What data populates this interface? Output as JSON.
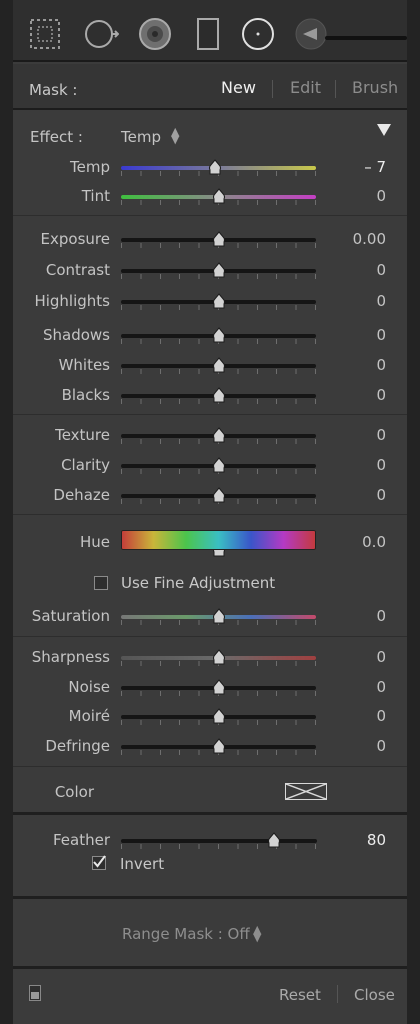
{
  "mask": {
    "label": "Mask :",
    "buttons": [
      "New",
      "Edit",
      "Brush"
    ],
    "active": "New"
  },
  "toolbar": {
    "tools": [
      "marquee-icon",
      "spot-removal-icon",
      "redeye-icon",
      "graduated-filter-icon",
      "radial-filter-icon",
      "brush-tool-icon"
    ]
  },
  "effect": {
    "label": "Effect :",
    "value": "Temp",
    "collapse_icon": "triangle-down-icon"
  },
  "sliders": [
    {
      "label": "Temp",
      "value": "– 7",
      "position": 0.48,
      "track": "temp"
    },
    {
      "label": "Tint",
      "value": "0",
      "position": 0.5,
      "track": "tint"
    },
    {
      "label": "Exposure",
      "value": "0.00",
      "position": 0.5,
      "track": "plain"
    },
    {
      "label": "Contrast",
      "value": "0",
      "position": 0.5,
      "track": "plain"
    },
    {
      "label": "Highlights",
      "value": "0",
      "position": 0.5,
      "track": "plain"
    },
    {
      "label": "Shadows",
      "value": "0",
      "position": 0.5,
      "track": "plain"
    },
    {
      "label": "Whites",
      "value": "0",
      "position": 0.5,
      "track": "plain"
    },
    {
      "label": "Blacks",
      "value": "0",
      "position": 0.5,
      "track": "plain"
    },
    {
      "label": "Texture",
      "value": "0",
      "position": 0.5,
      "track": "plain"
    },
    {
      "label": "Clarity",
      "value": "0",
      "position": 0.5,
      "track": "plain"
    },
    {
      "label": "Dehaze",
      "value": "0",
      "position": 0.5,
      "track": "plain"
    },
    {
      "label": "Hue",
      "value": "0.0",
      "position": 0.5,
      "track": "hue"
    },
    {
      "label": "Saturation",
      "value": "0",
      "position": 0.5,
      "track": "saturation"
    },
    {
      "label": "Sharpness",
      "value": "0",
      "position": 0.5,
      "track": "sharpness"
    },
    {
      "label": "Noise",
      "value": "0",
      "position": 0.5,
      "track": "plain"
    },
    {
      "label": "Moiré",
      "value": "0",
      "position": 0.5,
      "track": "plain"
    },
    {
      "label": "Defringe",
      "value": "0",
      "position": 0.5,
      "track": "plain"
    },
    {
      "label": "Feather",
      "value": "80",
      "position": 0.78,
      "track": "plain"
    }
  ],
  "fine_adjustment": {
    "label": "Use Fine Adjustment",
    "checked": false
  },
  "color": {
    "label": "Color",
    "swatch": "none"
  },
  "invert": {
    "label": "Invert",
    "checked": true
  },
  "range_mask": {
    "label": "Range Mask : Off"
  },
  "footer": {
    "reset": "Reset",
    "close": "Close"
  },
  "colors": {
    "panel": "#3b3b3b",
    "text": "#c4c4c4",
    "active": "#f0f0f0"
  }
}
